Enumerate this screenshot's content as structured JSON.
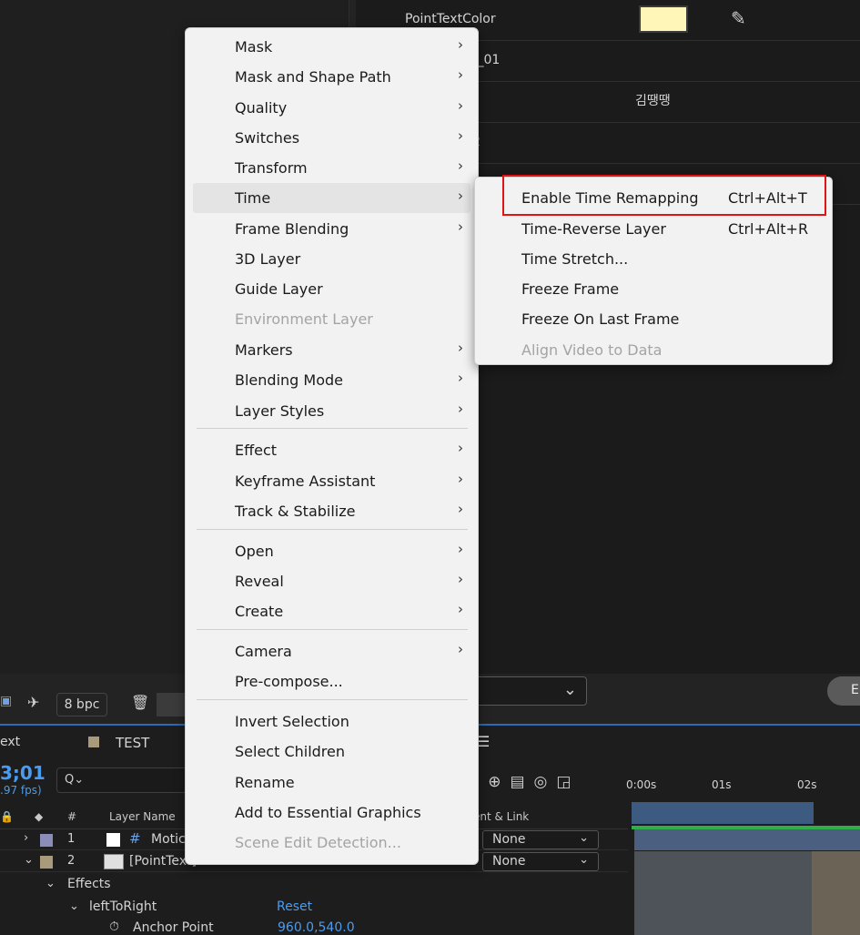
{
  "effect_controls": {
    "rows": [
      {
        "label": "PointTextColor"
      },
      {
        "label": "t_01"
      },
      {
        "label": "김땡땡"
      },
      {
        "label": "2"
      }
    ],
    "swatch_color": "#fff6b8",
    "dropdown_chevron": "❯",
    "button_label": "E"
  },
  "project_panel": {
    "bpc_label": "8 bpc"
  },
  "timeline": {
    "tab_partial": "ext",
    "tab_name": "TEST",
    "timecode": "3;01",
    "fps": ".97 fps)",
    "search_placeholder": "Q⌄",
    "headers": {
      "num": "#",
      "layer_name": "Layer Name",
      "parent_link": "ent & Link"
    },
    "ruler": [
      "0:00s",
      "01s",
      "02s"
    ],
    "layers": [
      {
        "num": "1",
        "name": "Motic",
        "parent": "None",
        "color": "#8c8cb8"
      },
      {
        "num": "2",
        "name": "[PointText]",
        "parent": "None",
        "color": "#a89a7a"
      }
    ],
    "effects_label": "Effects",
    "effect_name": "leftToRight",
    "reset_label": "Reset",
    "anchor_label": "Anchor Point",
    "anchor_value": "960.0,540.0"
  },
  "context_menu": {
    "items": [
      {
        "label": "Mask",
        "submenu": true,
        "disabled": false
      },
      {
        "label": "Mask and Shape Path",
        "submenu": true,
        "disabled": false
      },
      {
        "label": "Quality",
        "submenu": true,
        "disabled": false
      },
      {
        "label": "Switches",
        "submenu": true,
        "disabled": false
      },
      {
        "label": "Transform",
        "submenu": true,
        "disabled": false
      },
      {
        "label": "Time",
        "submenu": true,
        "disabled": false,
        "highlighted": true
      },
      {
        "label": "Frame Blending",
        "submenu": true,
        "disabled": false
      },
      {
        "label": "3D Layer",
        "submenu": false,
        "disabled": false
      },
      {
        "label": "Guide Layer",
        "submenu": false,
        "disabled": false
      },
      {
        "label": "Environment Layer",
        "submenu": false,
        "disabled": true
      },
      {
        "label": "Markers",
        "submenu": true,
        "disabled": false
      },
      {
        "label": "Blending Mode",
        "submenu": true,
        "disabled": false
      },
      {
        "label": "Layer Styles",
        "submenu": true,
        "disabled": false
      },
      {
        "label": "Effect",
        "submenu": true,
        "disabled": false
      },
      {
        "label": "Keyframe Assistant",
        "submenu": true,
        "disabled": false
      },
      {
        "label": "Track & Stabilize",
        "submenu": true,
        "disabled": false
      },
      {
        "label": "Open",
        "submenu": true,
        "disabled": false
      },
      {
        "label": "Reveal",
        "submenu": true,
        "disabled": false
      },
      {
        "label": "Create",
        "submenu": true,
        "disabled": false
      },
      {
        "label": "Camera",
        "submenu": true,
        "disabled": false
      },
      {
        "label": "Pre-compose...",
        "submenu": false,
        "disabled": false
      },
      {
        "label": "Invert Selection",
        "submenu": false,
        "disabled": false
      },
      {
        "label": "Select Children",
        "submenu": false,
        "disabled": false
      },
      {
        "label": "Rename",
        "submenu": false,
        "disabled": false
      },
      {
        "label": "Add to Essential Graphics",
        "submenu": false,
        "disabled": false
      },
      {
        "label": "Scene Edit Detection...",
        "submenu": false,
        "disabled": true
      }
    ],
    "arrow_glyph": "›"
  },
  "time_submenu": {
    "items": [
      {
        "label": "Enable Time Remapping",
        "shortcut": "Ctrl+Alt+T",
        "disabled": false,
        "annotated": true
      },
      {
        "label": "Time-Reverse Layer",
        "shortcut": "Ctrl+Alt+R",
        "disabled": false
      },
      {
        "label": "Time Stretch...",
        "shortcut": "",
        "disabled": false
      },
      {
        "label": "Freeze Frame",
        "shortcut": "",
        "disabled": false
      },
      {
        "label": "Freeze On Last Frame",
        "shortcut": "",
        "disabled": false
      },
      {
        "label": "Align Video to Data",
        "shortcut": "",
        "disabled": true
      }
    ]
  },
  "colors": {
    "annotation_red": "#e01414",
    "timecode_blue": "#4a9cf0",
    "menu_bg": "#f2f2f2"
  }
}
